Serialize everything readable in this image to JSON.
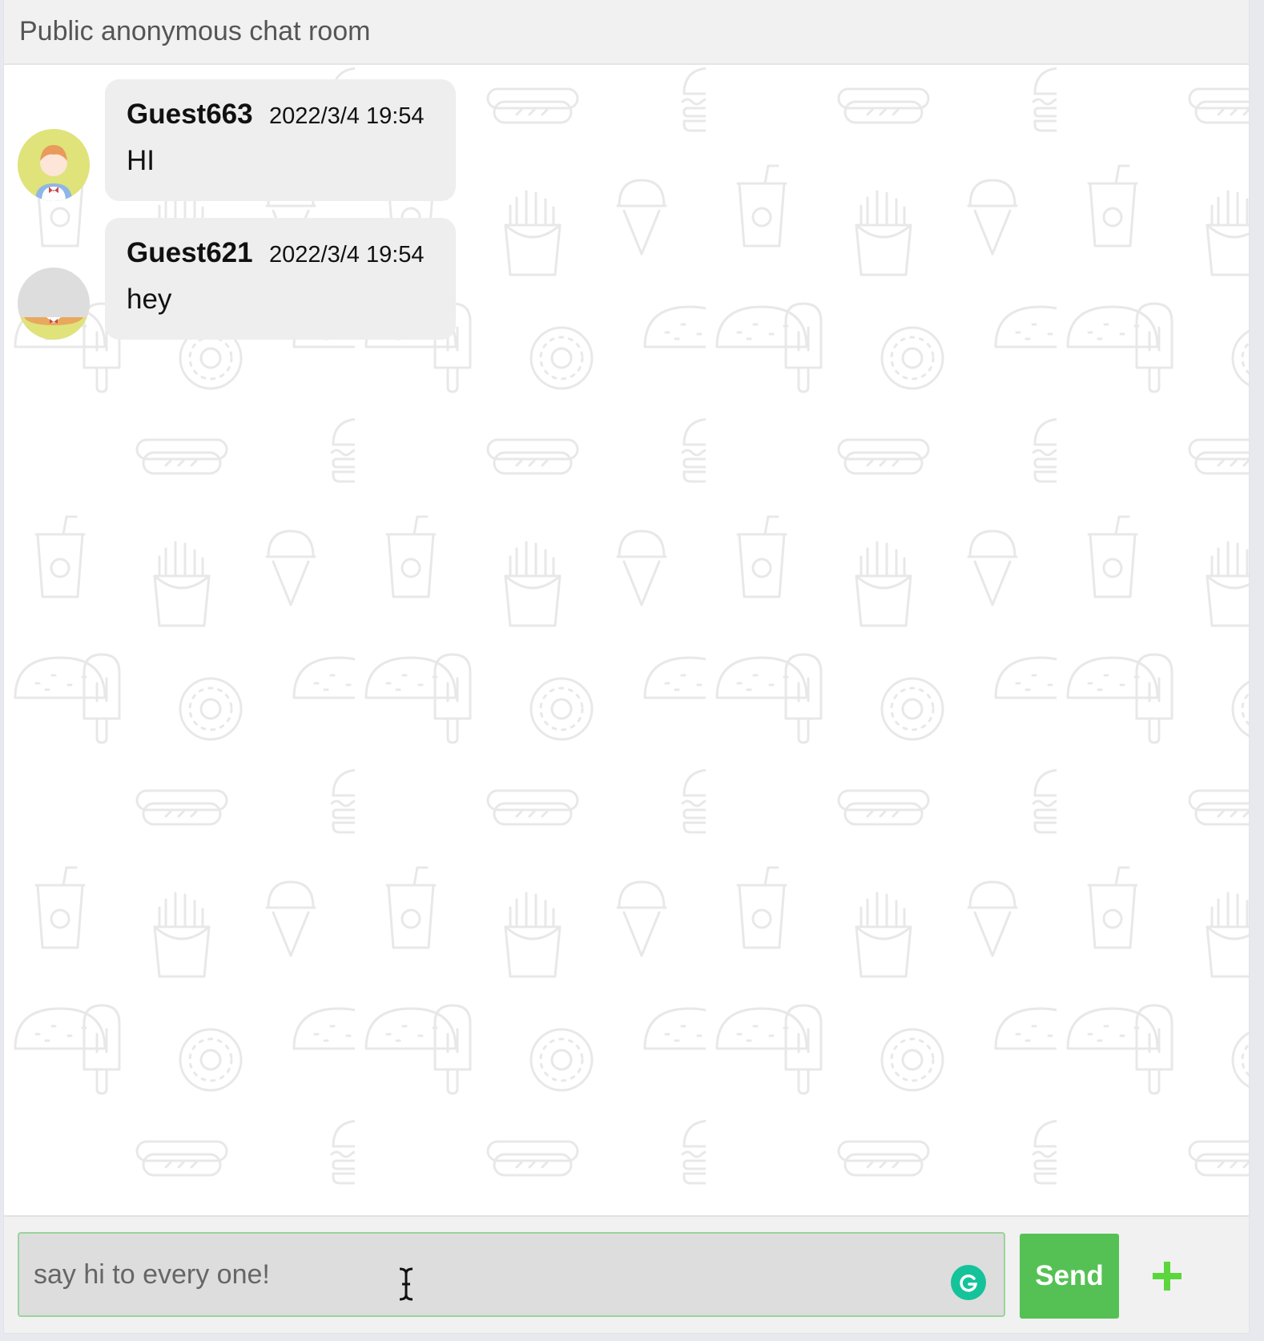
{
  "header": {
    "title": "Public anonymous chat room"
  },
  "messages": [
    {
      "username": "Guest663",
      "time": "2022/3/4 19:54",
      "text": "HI",
      "avatar_icon": "female-avatar-icon"
    },
    {
      "username": "Guest621",
      "time": "2022/3/4 19:54",
      "text": "hey",
      "avatar_icon": "gray-avatar-icon"
    }
  ],
  "composer": {
    "placeholder": "say hi to every one!",
    "send_label": "Send",
    "add_icon": "plus-icon",
    "grammarly_icon": "grammarly-icon"
  },
  "colors": {
    "send_button": "#55c155",
    "input_border": "#9bd39c",
    "bubble": "#eeeeee",
    "header": "#f1f1f1",
    "pattern": "#ececec"
  }
}
